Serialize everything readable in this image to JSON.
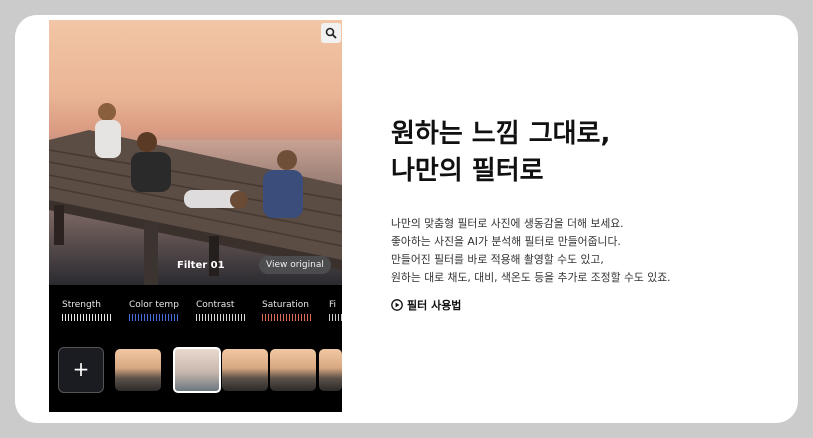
{
  "headline": {
    "line1": "원하는 느낌 그대로,",
    "line2": "나만의 필터로"
  },
  "description": [
    "나만의 맞춤형 필터로 사진에 생동감을 더해 보세요.",
    "좋아하는 사진을 AI가 분석해 필터로 만들어줍니다.",
    "만들어진 필터를 바로 적용해 촬영할 수도 있고,",
    "원하는 대로 채도, 대비, 색온도 등을 추가로 조정할 수도 있죠."
  ],
  "how_to_label": "필터 사용법",
  "phone": {
    "filter_name": "Filter 01",
    "view_original_label": "View original",
    "add_label": "+",
    "sliders": [
      {
        "label": "Strength",
        "color": "#e8e8e8"
      },
      {
        "label": "Color temp",
        "color": "#4a6ee0"
      },
      {
        "label": "Contrast",
        "color": "#d8d8d8"
      },
      {
        "label": "Saturation",
        "color": "#e06a5a"
      },
      {
        "label": "Fi",
        "color": "#cccccc"
      }
    ]
  },
  "icons": {
    "zoom": "magnifier-icon",
    "play": "play-circle-icon"
  }
}
